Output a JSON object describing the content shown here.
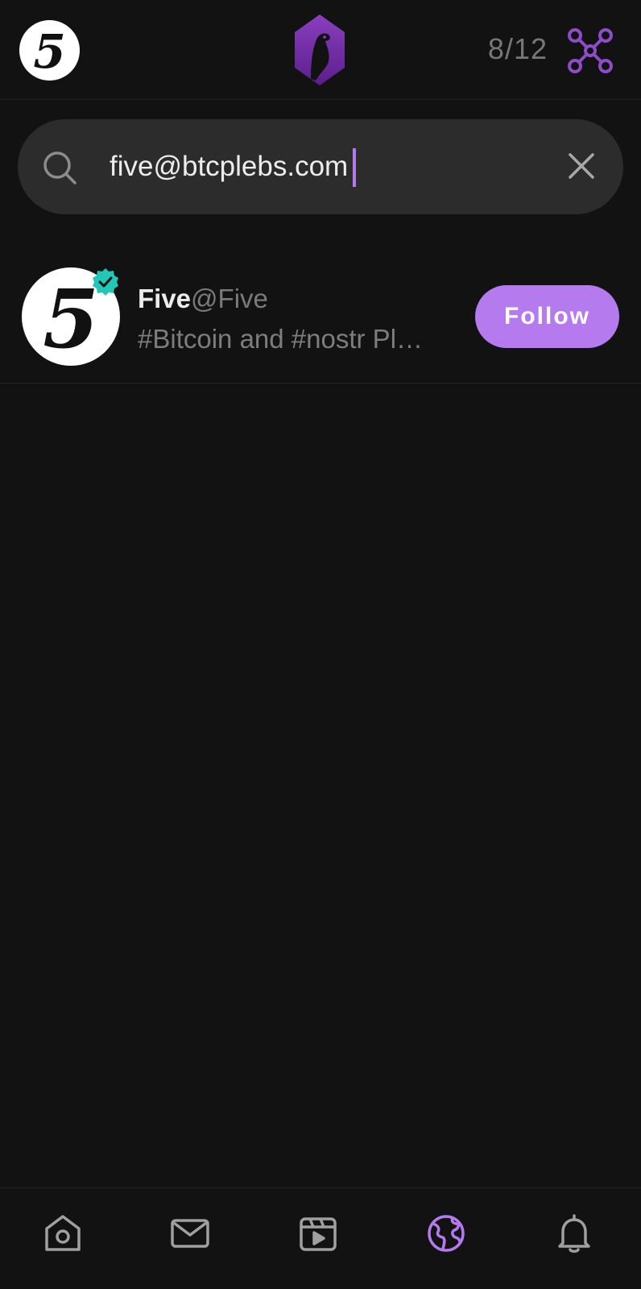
{
  "header": {
    "avatar_glyph": "5",
    "logo_icon": "nostr-ostrich-logo",
    "relay_count": "8/12",
    "relay_icon": "relay-network-icon",
    "accent_color": "#b57bee"
  },
  "search": {
    "value": "five@btcplebs.com",
    "search_icon": "search-icon",
    "clear_icon": "close-icon"
  },
  "results": [
    {
      "avatar_glyph": "5",
      "verified": true,
      "verified_color": "#22c7b8",
      "display_name": "Five",
      "handle": "@Five",
      "about": "#Bitcoin and #nostr Pl…",
      "follow_label": "Follow"
    }
  ],
  "nav": {
    "items": [
      {
        "icon": "home-icon",
        "active": false
      },
      {
        "icon": "mail-icon",
        "active": false
      },
      {
        "icon": "video-icon",
        "active": false
      },
      {
        "icon": "globe-icon",
        "active": true
      },
      {
        "icon": "bell-icon",
        "active": false
      }
    ]
  }
}
